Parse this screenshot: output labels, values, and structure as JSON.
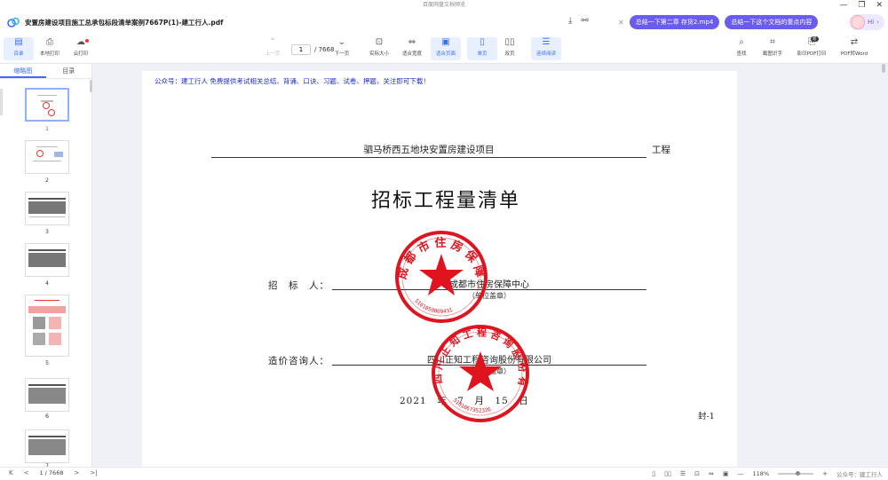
{
  "window": {
    "title": "百度网盘文档预览",
    "minimize": "—",
    "maximize": "❐",
    "close": "✕"
  },
  "file": {
    "name": "安置房建设项目施工总承包标段清单案例7667P(1)-建工行人.pdf"
  },
  "ai_bar": {
    "chip1": "总结一下第二章 存货2.mp4",
    "chip2": "总结一下这个文档的重点内容",
    "greeting": "Hi"
  },
  "toolbar": {
    "catalog": "目录",
    "local_print": "本地打印",
    "cloud_print": "云打印",
    "prev_page": "上一页",
    "current_page": "1",
    "total_pages": "/ 7668",
    "next_page": "下一页",
    "actual_size": "实际大小",
    "fit_width": "适合宽度",
    "fit_page": "适合页面",
    "single_page": "单页",
    "double_page": "双页",
    "continuous": "连续阅读",
    "find": "查找",
    "ocr": "截图识字",
    "scan_print": "影印PDF打印",
    "pdf_to_word": "PDF转Word",
    "new_badge": "新"
  },
  "sidebar": {
    "tab_thumbs": "缩略图",
    "tab_toc": "目录",
    "thumbs": [
      "1",
      "2",
      "3",
      "4",
      "5",
      "6",
      "7"
    ]
  },
  "document": {
    "notice": "公众号：建工行人 免费提供考试相关总结、背诵、口诀、习题、试卷、押题，关注即可下载！",
    "project": "驷马桥西五地块安置房建设项目",
    "project_suffix": "工程",
    "title": "招标工程量清单",
    "tenderer_label": "招　标　人：",
    "tenderer_value": "成都市住房保障中心",
    "tenderer_sub": "（单位盖章）",
    "consultant_label": "造价咨询人：",
    "consultant_value": "四川正知工程咨询股份有限公司",
    "consultant_sub": "（单位盖章）",
    "date": "2021　年　7　月　15　日",
    "cover_code": "封-1",
    "stamp1_text": "成都市住房保障中心",
    "stamp1_code": "5101050009431",
    "stamp2_text": "四川正知工程咨询股份有限公司",
    "stamp2_code": "5101067352326"
  },
  "statusbar": {
    "first": "K",
    "prev": "<",
    "page": "1 / 7668",
    "next": ">",
    "last": ">|",
    "zoom": "118%",
    "zoom_minus": "—",
    "zoom_plus": "+",
    "watermark": "公众号：建工行人"
  },
  "colors": {
    "accent": "#3a6ff7",
    "ai_chip": "#6b5cf0",
    "notice_text": "#1f2bd3",
    "stamp_red": "#e0141e"
  }
}
